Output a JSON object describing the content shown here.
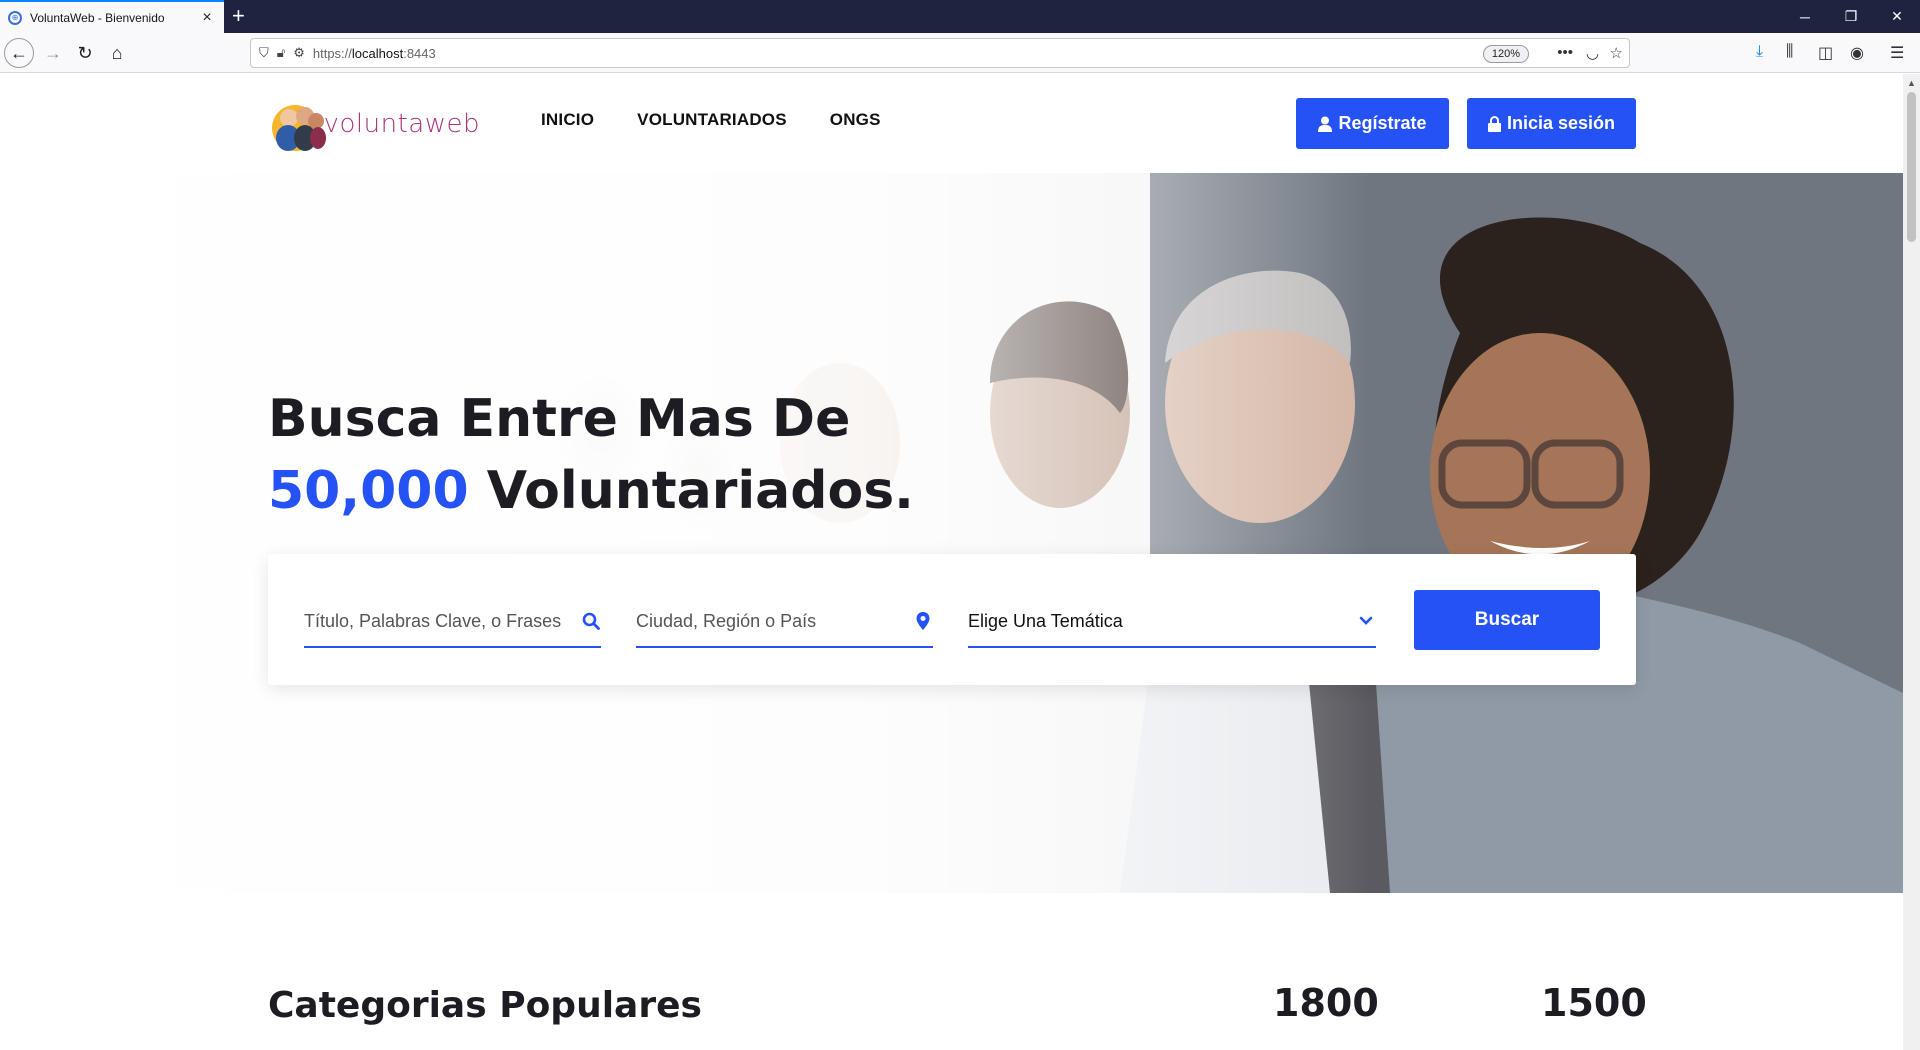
{
  "browser": {
    "tab_title": "VoluntaWeb - Bienvenido",
    "new_tab": "+",
    "url_scheme": "https://",
    "url_host": "localhost",
    "url_port": ":8443",
    "zoom": "120%"
  },
  "header": {
    "logo_text": "voluntaweb",
    "nav": [
      "INICIO",
      "VOLUNTARIADOS",
      "ONGS"
    ],
    "register_label": "Regístrate",
    "login_label": "Inicia sesión"
  },
  "hero": {
    "title_line1": "Busca Entre Mas De",
    "title_number": "50,000",
    "title_line2_rest": " Voluntariados."
  },
  "search": {
    "keywords_placeholder": "Título, Palabras Clave, o Frases",
    "location_placeholder": "Ciudad, Región o País",
    "theme_selected": "Elige Una Temática",
    "button_label": "Buscar"
  },
  "popular": {
    "title": "Categorias Populares",
    "stats": [
      "1800",
      "1500"
    ]
  },
  "colors": {
    "accent": "#2452f5",
    "logo": "#a8377e",
    "titlebar": "#202340"
  }
}
